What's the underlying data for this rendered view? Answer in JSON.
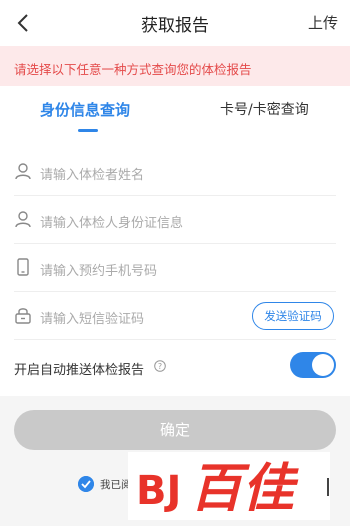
{
  "nav": {
    "title": "获取报告",
    "upload_label": "上传"
  },
  "notice": {
    "text": "请选择以下任意一种方式查询您的体检报告"
  },
  "tabs": [
    {
      "label": "身份信息查询",
      "active": true
    },
    {
      "label": "卡号/卡密查询",
      "active": false
    }
  ],
  "fields": {
    "name": {
      "placeholder": "请输入体检者姓名",
      "icon": "user-icon"
    },
    "id": {
      "placeholder": "请输入体检人身份证信息",
      "icon": "user-icon"
    },
    "phone": {
      "placeholder": "请输入预约手机号码",
      "icon": "phone-icon"
    },
    "sms": {
      "placeholder": "请输入短信验证码",
      "icon": "lock-icon",
      "button_label": "发送验证码"
    }
  },
  "push": {
    "label": "开启自动推送体检报告",
    "enabled": true
  },
  "confirm_label": "确定",
  "agreement": {
    "checked": true,
    "text": "我已阅"
  },
  "watermark": {
    "text": "百佳"
  },
  "colors": {
    "accent": "#2f86e8",
    "notice_bg": "#fde9ea",
    "notice_text": "#e44a4a",
    "watermark_red": "#e8332a",
    "disabled_button": "#c9c9c9"
  }
}
